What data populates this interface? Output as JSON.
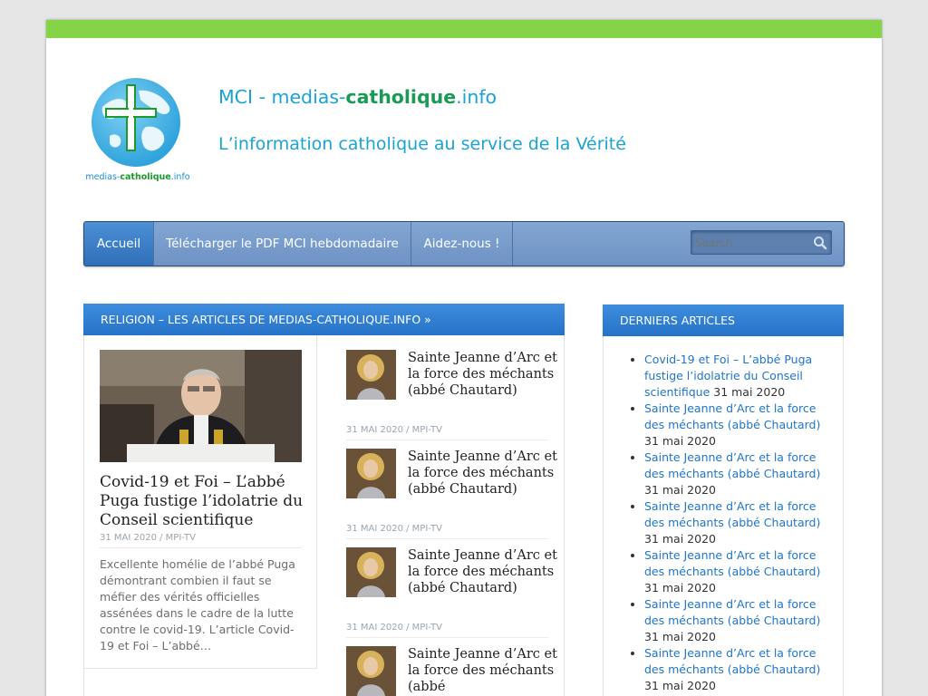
{
  "header": {
    "logo_text_a": "medias-",
    "logo_text_b": "catholique",
    "logo_text_c": ".info",
    "title_a": "MCI - medias-",
    "title_b": "catholique",
    "title_c": ".info",
    "tagline": "L’information catholique au service de la Vérité"
  },
  "nav": {
    "items": [
      {
        "label": "Accueil",
        "active": true
      },
      {
        "label": "Télécharger le PDF MCI hebdomadaire"
      },
      {
        "label": "Aidez-nous !"
      }
    ],
    "search_value": "Search"
  },
  "main": {
    "heading": "RELIGION – LES ARTICLES DE MEDIAS-CATHOLIQUE.INFO »",
    "featured": {
      "title": "Covid-19 et Foi – L’abbé Puga fustige l’idolatrie du Conseil scientifique",
      "meta": "31 MAI 2020 / MPI-TV",
      "excerpt": "Excellente homélie de l’abbé Puga démontrant combien il faut se méfier des vérités officielles assénées dans le cadre de la lutte contre le covid-19. L’article Covid-19 et Foi – L’abbé…"
    },
    "list": [
      {
        "title": "Sainte Jeanne d’Arc et la force des méchants (abbé Chautard)",
        "meta": "31 MAI 2020 / MPI-TV"
      },
      {
        "title": "Sainte Jeanne d’Arc et la force des méchants (abbé Chautard)",
        "meta": "31 MAI 2020 / MPI-TV"
      },
      {
        "title": "Sainte Jeanne d’Arc et la force des méchants (abbé Chautard)",
        "meta": "31 MAI 2020 / MPI-TV"
      },
      {
        "title": "Sainte Jeanne d’Arc et la force des méchants (abbé",
        "meta": ""
      }
    ]
  },
  "sidebar": {
    "heading": "DERNIERS ARTICLES",
    "items": [
      {
        "link": "Covid-19 et Foi – L’abbé Puga fustige l’idolatrie du Conseil scientifique",
        "date": "31 mai 2020"
      },
      {
        "link": "Sainte Jeanne d’Arc et la force des méchants (abbé Chautard)",
        "date": "31 mai 2020"
      },
      {
        "link": "Sainte Jeanne d’Arc et la force des méchants (abbé Chautard)",
        "date": "31 mai 2020"
      },
      {
        "link": "Sainte Jeanne d’Arc et la force des méchants (abbé Chautard)",
        "date": "31 mai 2020"
      },
      {
        "link": "Sainte Jeanne d’Arc et la force des méchants (abbé Chautard)",
        "date": "31 mai 2020"
      },
      {
        "link": "Sainte Jeanne d’Arc et la force des méchants (abbé Chautard)",
        "date": "31 mai 2020"
      },
      {
        "link": "Sainte Jeanne d’Arc et la force des méchants (abbé Chautard)",
        "date": "31 mai 2020"
      }
    ]
  },
  "colors": {
    "top_bar": "#84d445",
    "nav": "#6d92c4",
    "nav_active": "#2f6fb8",
    "widget_head": "#2572c8",
    "link": "#2075c9",
    "title": "#19a3d6"
  },
  "icons": {
    "search": "magnifier-icon"
  }
}
